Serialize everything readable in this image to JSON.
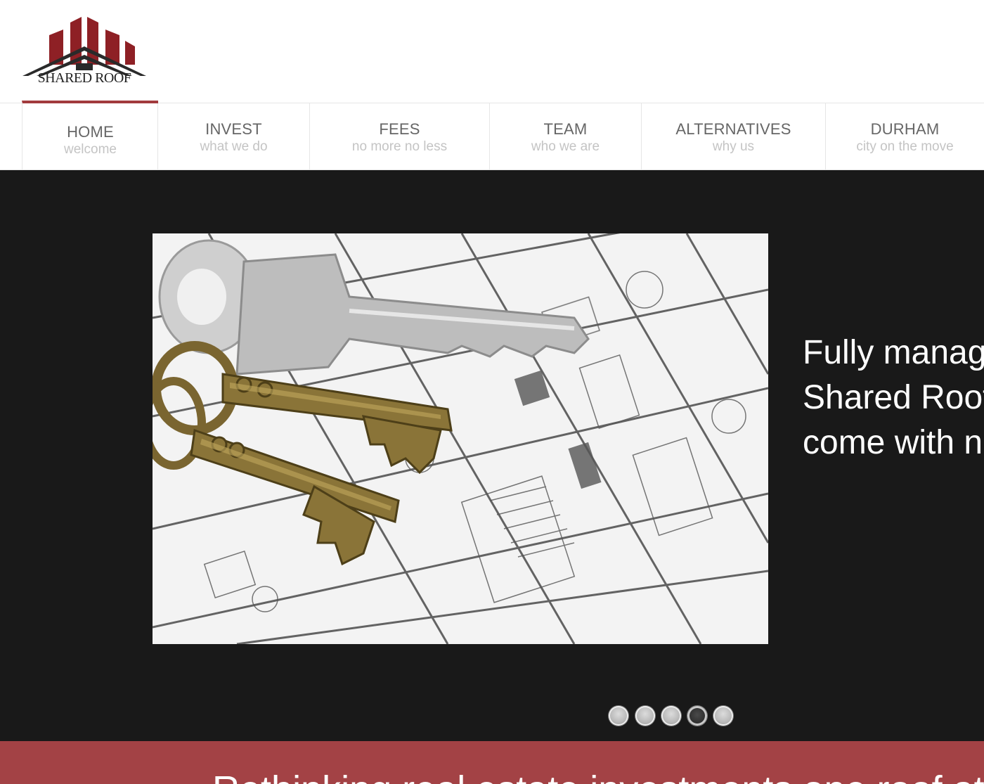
{
  "header": {
    "logo_text": "SHARED ROOF"
  },
  "nav": {
    "items": [
      {
        "title": "HOME",
        "subtitle": "welcome"
      },
      {
        "title": "INVEST",
        "subtitle": "what we do"
      },
      {
        "title": "FEES",
        "subtitle": "no more no less"
      },
      {
        "title": "TEAM",
        "subtitle": "who we are"
      },
      {
        "title": "ALTERNATIVES",
        "subtitle": "why us"
      },
      {
        "title": "DURHAM",
        "subtitle": "city on the move"
      }
    ],
    "active_index": 0
  },
  "slider": {
    "image": "keys-on-floor-plan",
    "caption_lines": [
      "Fully manag",
      "Shared Roof",
      "come with n"
    ],
    "dot_count": 5,
    "active_dot": 3
  },
  "banner": {
    "text": "Rethinking real estate investments one roof at a time"
  },
  "colors": {
    "brand_red": "#a23b3d",
    "slider_bg": "#191919",
    "banner_bg": "#a34245",
    "nav_title": "#666666",
    "nav_subtitle": "#c4c4c4"
  }
}
